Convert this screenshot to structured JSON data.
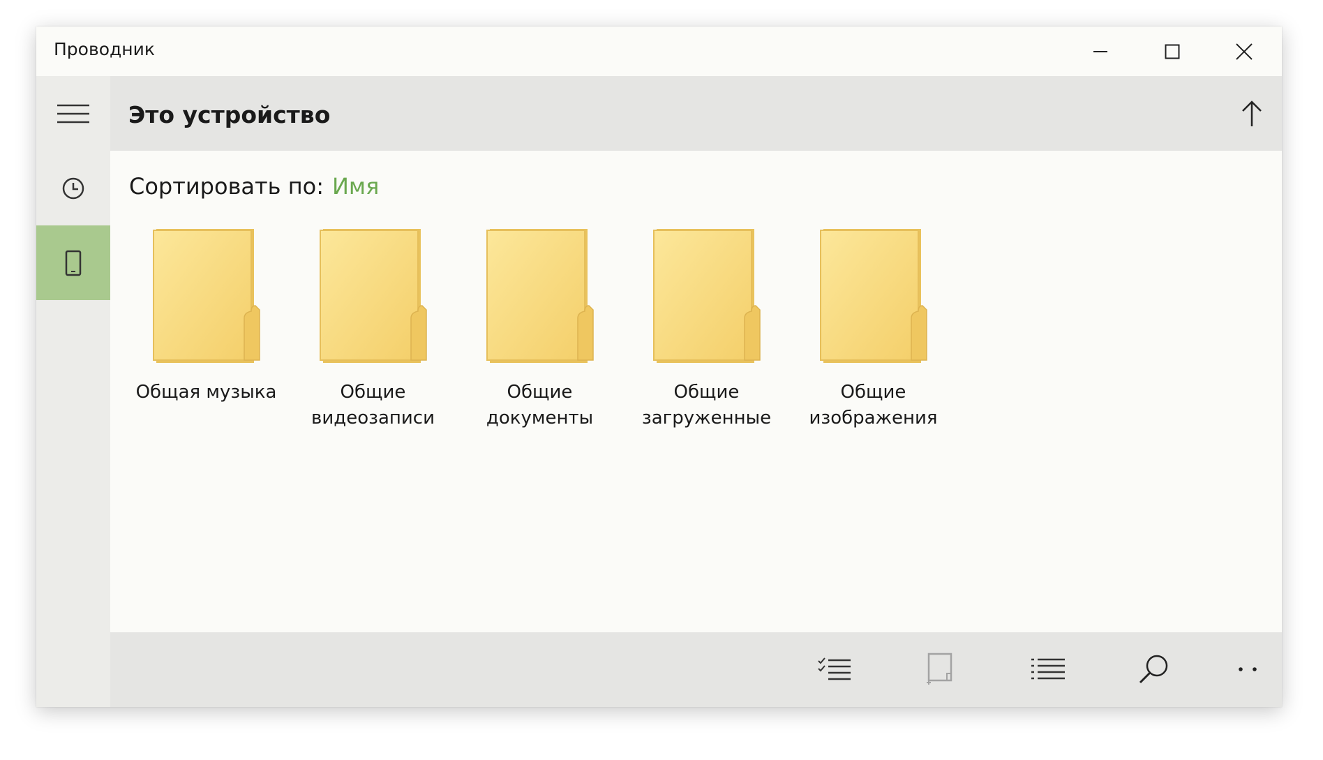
{
  "window": {
    "title": "Проводник"
  },
  "header": {
    "title": "Это устройство"
  },
  "sort": {
    "label": "Сортировать по:",
    "value": "Имя"
  },
  "folders": [
    {
      "label": "Общая музыка"
    },
    {
      "label": "Общие видеозаписи"
    },
    {
      "label": "Общие документы"
    },
    {
      "label": "Общие загруженные"
    },
    {
      "label": "Общие изображения"
    }
  ],
  "colors": {
    "accent": "#6aa84f",
    "selected_nav": "#a9c98e",
    "folder": "#f8d775"
  },
  "icons": {
    "sidebar": [
      "hamburger-menu-icon",
      "clock-icon",
      "phone-icon"
    ],
    "toolbar": [
      "select-list-icon",
      "new-folder-icon",
      "list-view-icon",
      "search-icon",
      "more-icon"
    ]
  }
}
